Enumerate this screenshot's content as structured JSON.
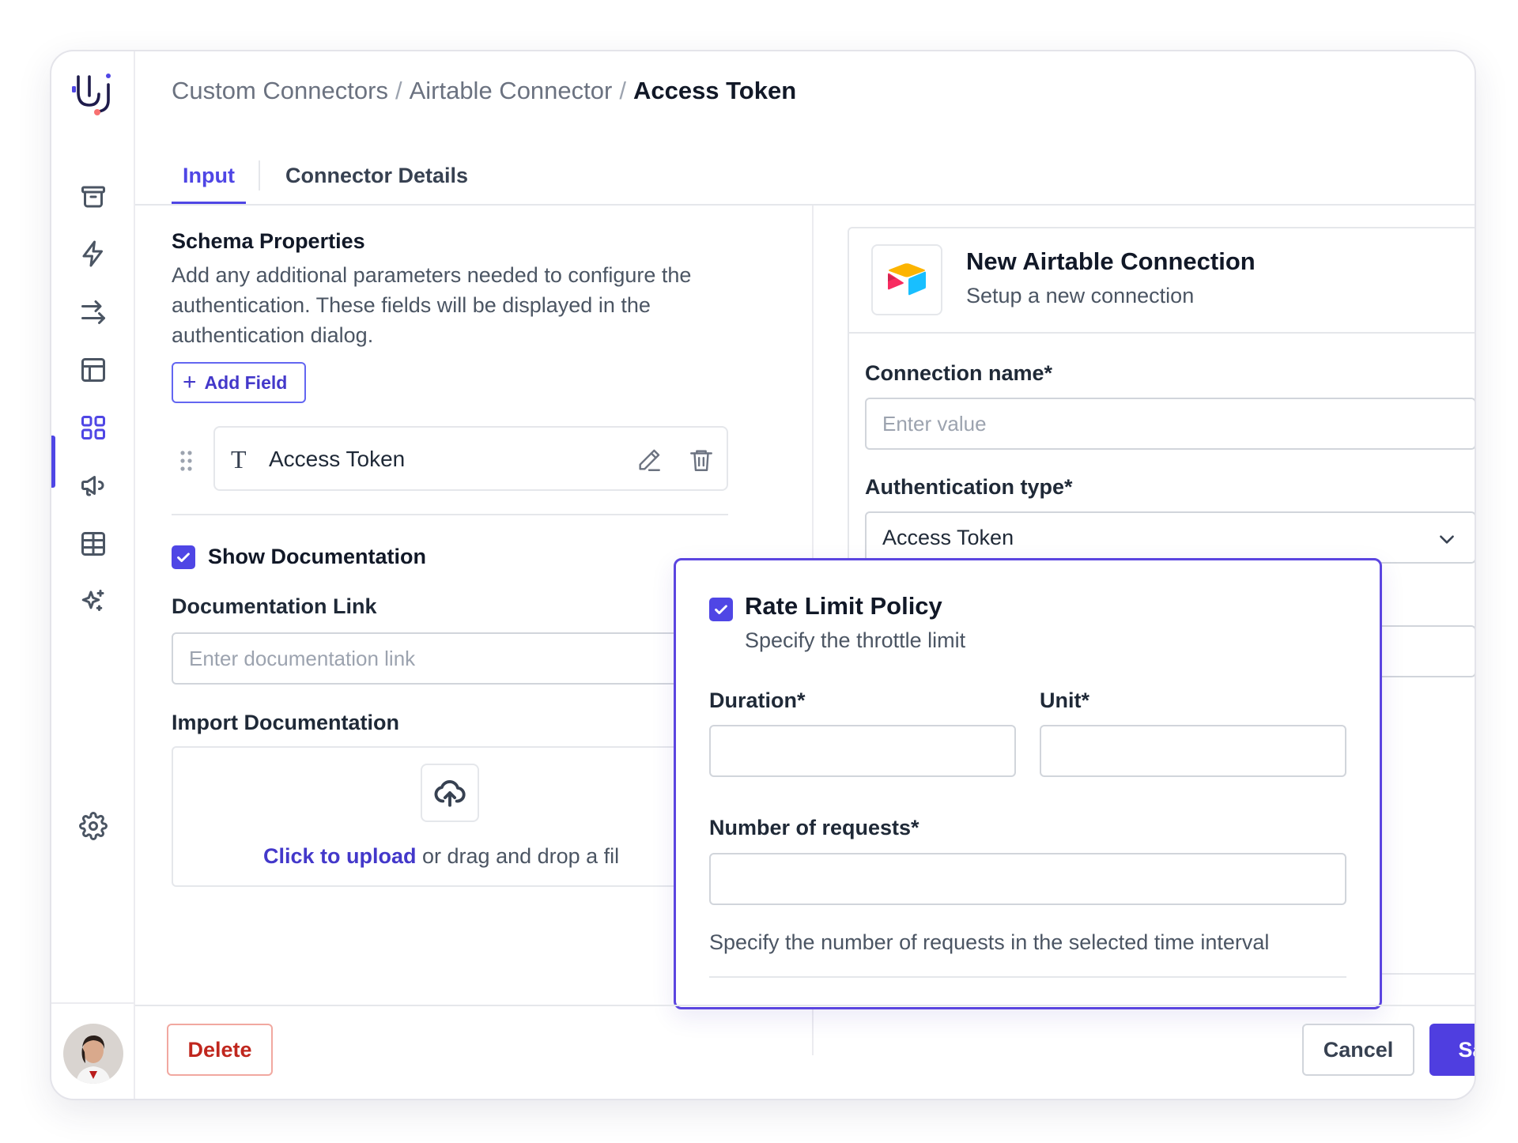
{
  "breadcrumb": {
    "items": [
      "Custom Connectors",
      "Airtable Connector"
    ],
    "current": "Access Token",
    "separator": "/"
  },
  "tabs": [
    {
      "label": "Input",
      "active": true
    },
    {
      "label": "Connector Details",
      "active": false
    }
  ],
  "sidebar": {
    "items": [
      {
        "icon": "archive-icon"
      },
      {
        "icon": "lightning-icon"
      },
      {
        "icon": "arrows-right-icon"
      },
      {
        "icon": "layout-icon"
      },
      {
        "icon": "grid-icon",
        "active": true
      },
      {
        "icon": "megaphone-icon"
      },
      {
        "icon": "table-icon"
      },
      {
        "icon": "sparkles-icon"
      },
      {
        "icon": "gear-icon"
      }
    ]
  },
  "schema": {
    "heading": "Schema Properties",
    "description": "Add any additional parameters needed to configure the authentication. These fields will be displayed in the authentication dialog.",
    "add_field_label": "Add Field",
    "fields": [
      {
        "type_icon": "T",
        "label": "Access Token"
      }
    ]
  },
  "documentation": {
    "show_label": "Show Documentation",
    "show_checked": true,
    "link_label": "Documentation Link",
    "link_placeholder": "Enter documentation link",
    "import_label": "Import Documentation",
    "upload_link": "Click to upload",
    "upload_text": " or drag and drop a fil"
  },
  "connection_card": {
    "title": "New Airtable Connection",
    "subtitle": "Setup a new connection",
    "name_label": "Connection name*",
    "name_placeholder": "Enter value",
    "auth_label": "Authentication type*",
    "auth_value": "Access Token"
  },
  "rate_limit": {
    "checked": true,
    "title": "Rate Limit Policy",
    "subtitle": "Specify the throttle limit",
    "duration_label": "Duration*",
    "unit_label": "Unit*",
    "requests_label": "Number of requests*",
    "help": "Specify the number of requests in the selected time interval"
  },
  "footer": {
    "delete_label": "Delete",
    "cancel_label": "Cancel",
    "save_label": "Save"
  },
  "colors": {
    "accent": "#4f46e5",
    "danger": "#c0271e",
    "border": "#e5e7eb"
  }
}
